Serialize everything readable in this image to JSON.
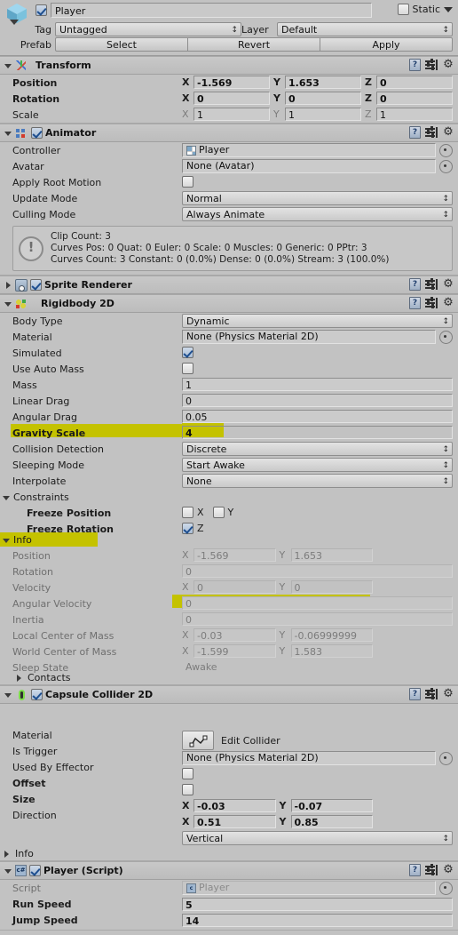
{
  "header": {
    "object_name": "Player",
    "enabled": true,
    "static_label": "Static",
    "static_checked": false,
    "tag_label": "Tag",
    "tag_value": "Untagged",
    "layer_label": "Layer",
    "layer_value": "Default",
    "prefab_label": "Prefab",
    "prefab_buttons": [
      "Select",
      "Revert",
      "Apply"
    ]
  },
  "transform": {
    "title": "Transform",
    "rows": [
      {
        "label": "Position",
        "bold": true,
        "x": "-1.569",
        "y": "1.653",
        "z": "0"
      },
      {
        "label": "Rotation",
        "bold": true,
        "x": "0",
        "y": "0",
        "z": "0"
      },
      {
        "label": "Scale",
        "bold": false,
        "x": "1",
        "y": "1",
        "z": "1"
      }
    ]
  },
  "animator": {
    "title": "Animator",
    "enabled": true,
    "controller_label": "Controller",
    "controller_value": "Player",
    "avatar_label": "Avatar",
    "avatar_value": "None (Avatar)",
    "apply_root_motion_label": "Apply Root Motion",
    "apply_root_motion_checked": false,
    "update_mode_label": "Update Mode",
    "update_mode_value": "Normal",
    "culling_mode_label": "Culling Mode",
    "culling_mode_value": "Always Animate",
    "info_text": "Clip Count: 3\nCurves Pos: 0 Quat: 0 Euler: 0 Scale: 0 Muscles: 0 Generic: 0 PPtr: 3\nCurves Count: 3 Constant: 0 (0.0%) Dense: 0 (0.0%) Stream: 3 (100.0%)"
  },
  "sprite_renderer": {
    "title": "Sprite Renderer",
    "enabled": true,
    "expanded": false
  },
  "rigidbody2d": {
    "title": "Rigidbody 2D",
    "body_type_label": "Body Type",
    "body_type_value": "Dynamic",
    "material_label": "Material",
    "material_value": "None (Physics Material 2D)",
    "simulated_label": "Simulated",
    "simulated_checked": true,
    "use_auto_mass_label": "Use Auto Mass",
    "use_auto_mass_checked": false,
    "mass_label": "Mass",
    "mass_value": "1",
    "linear_drag_label": "Linear Drag",
    "linear_drag_value": "0",
    "angular_drag_label": "Angular Drag",
    "angular_drag_value": "0.05",
    "gravity_scale_label": "Gravity Scale",
    "gravity_scale_value": "4",
    "collision_detection_label": "Collision Detection",
    "collision_detection_value": "Discrete",
    "sleeping_mode_label": "Sleeping Mode",
    "sleeping_mode_value": "Start Awake",
    "interpolate_label": "Interpolate",
    "interpolate_value": "None",
    "constraints_label": "Constraints",
    "freeze_position_label": "Freeze Position",
    "freeze_position_x_label": "X",
    "freeze_position_x_checked": false,
    "freeze_position_y_label": "Y",
    "freeze_position_y_checked": false,
    "freeze_rotation_label": "Freeze Rotation",
    "freeze_rotation_z_label": "Z",
    "freeze_rotation_z_checked": true,
    "info_label": "Info",
    "info": {
      "position_label": "Position",
      "position_x": "-1.569",
      "position_y": "1.653",
      "rotation_label": "Rotation",
      "rotation_value": "0",
      "velocity_label": "Velocity",
      "velocity_x": "0",
      "velocity_y": "0",
      "angular_velocity_label": "Angular Velocity",
      "angular_velocity_value": "0",
      "inertia_label": "Inertia",
      "inertia_value": "0",
      "local_com_label": "Local Center of Mass",
      "local_com_x": "-0.03",
      "local_com_y": "-0.06999999",
      "world_com_label": "World Center of Mass",
      "world_com_x": "-1.599",
      "world_com_y": "1.583",
      "sleep_state_label": "Sleep State",
      "sleep_state_value": "Awake",
      "contacts_label": "Contacts"
    }
  },
  "capsule_collider": {
    "title": "Capsule Collider 2D",
    "enabled": true,
    "edit_collider_label": "Edit Collider",
    "material_label": "Material",
    "material_value": "None (Physics Material 2D)",
    "is_trigger_label": "Is Trigger",
    "is_trigger_checked": false,
    "used_by_effector_label": "Used By Effector",
    "used_by_effector_checked": false,
    "offset_label": "Offset",
    "offset_x": "-0.03",
    "offset_y": "-0.07",
    "size_label": "Size",
    "size_x": "0.51",
    "size_y": "0.85",
    "direction_label": "Direction",
    "direction_value": "Vertical",
    "info_label": "Info"
  },
  "player_script": {
    "title": "Player (Script)",
    "enabled": true,
    "script_label": "Script",
    "script_value": "Player",
    "run_speed_label": "Run Speed",
    "run_speed_value": "5",
    "jump_speed_label": "Jump Speed",
    "jump_speed_value": "14"
  },
  "axis": {
    "x": "X",
    "y": "Y",
    "z": "Z"
  },
  "colors": {
    "background": "#c2c2c2",
    "highlight": "#c4c200",
    "field": "#cbcbcb",
    "text": "#1b1b1b",
    "text_disabled": "#7c7c7c"
  }
}
